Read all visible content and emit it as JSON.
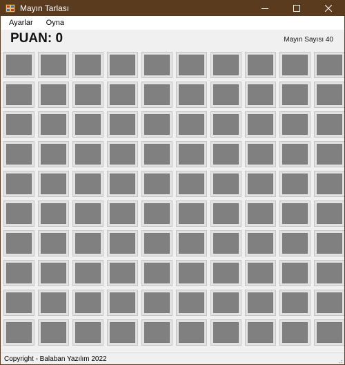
{
  "window": {
    "title": "Mayın Tarlası",
    "minimize_icon": "minimize-icon",
    "maximize_icon": "maximize-icon",
    "close_icon": "close-icon",
    "titlebar_color": "#5a3b1e"
  },
  "menu": {
    "items": [
      "Ayarlar",
      "Oyna"
    ]
  },
  "game": {
    "score_label": "PUAN: 0",
    "mine_count_label": "Mayın Sayısı 40",
    "rows": 10,
    "columns": 10,
    "cell_state": "covered",
    "cell_color": "#808080"
  },
  "status": {
    "text": "Copyright - Balaban Yazılım 2022"
  }
}
